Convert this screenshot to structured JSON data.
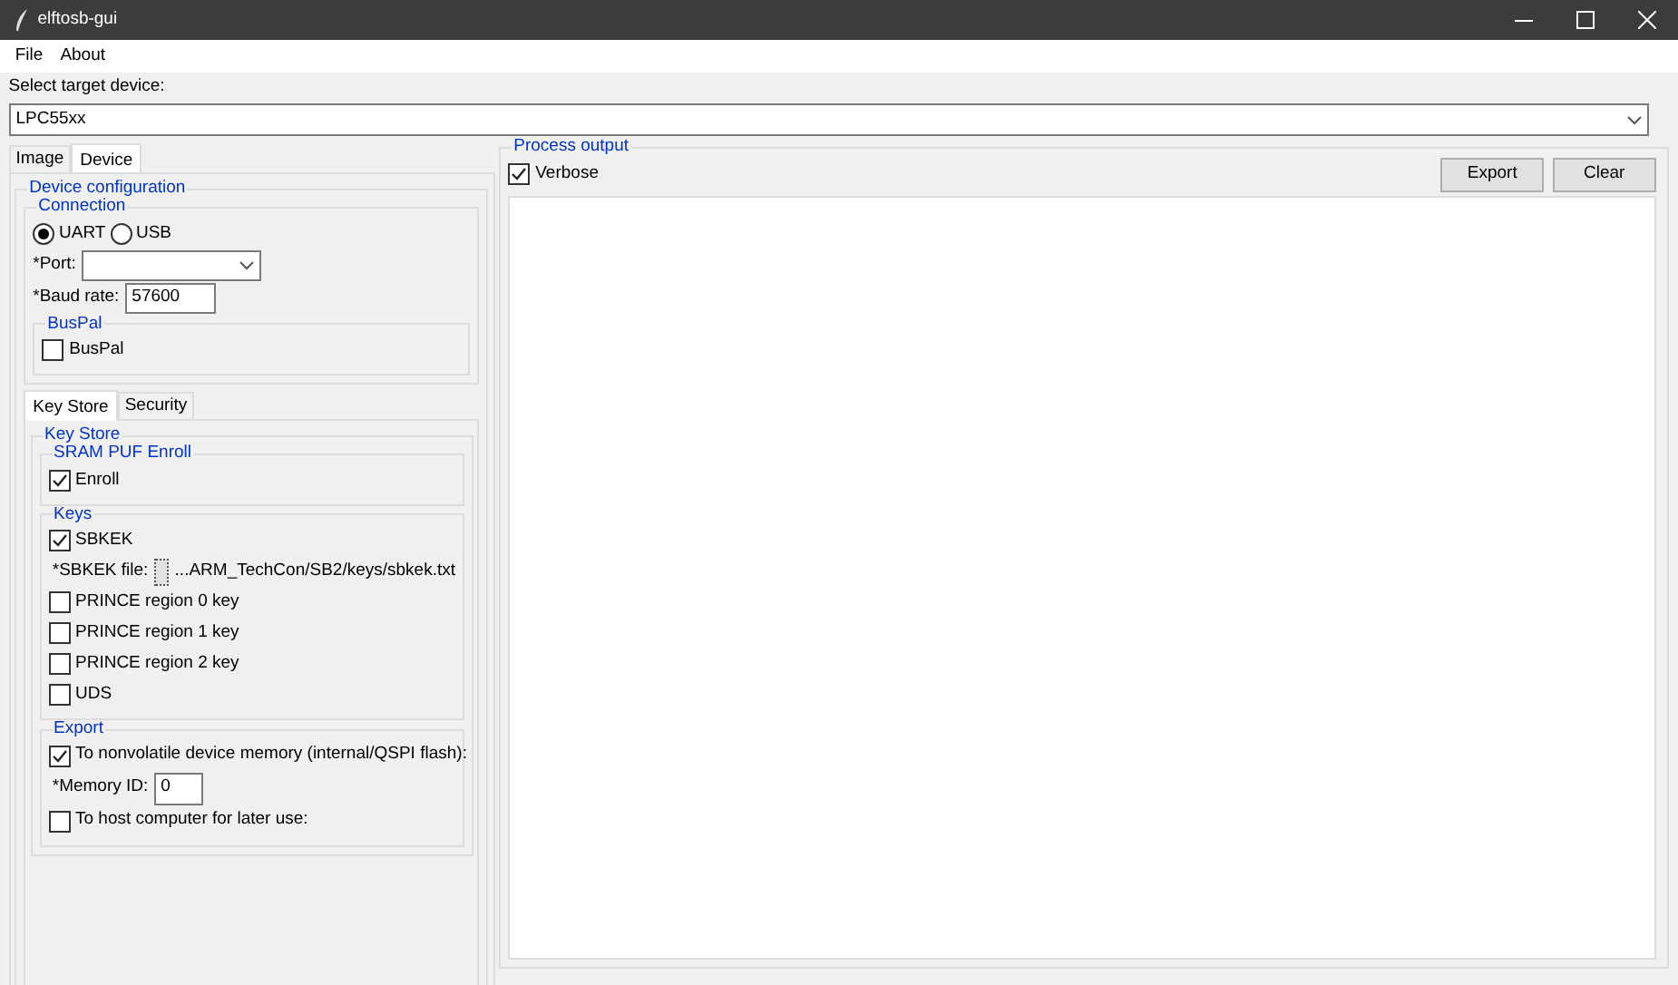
{
  "window": {
    "title": "elftosb-gui"
  },
  "menu": [
    "File",
    "About"
  ],
  "target_device": {
    "label": "Select target device:",
    "value": "LPC55xx"
  },
  "main_tabs": [
    {
      "label": "Image",
      "selected": false
    },
    {
      "label": "Device",
      "selected": true
    }
  ],
  "device_configuration": {
    "title": "Device configuration",
    "connection": {
      "title": "Connection",
      "radios": [
        {
          "label": "UART",
          "selected": true
        },
        {
          "label": "USB",
          "selected": false
        }
      ],
      "port": {
        "label": "*Port:"
      },
      "baud_rate": {
        "label": "*Baud rate:",
        "value": "57600"
      },
      "buspal": {
        "title": "BusPal",
        "checkbox": {
          "label": "BusPal",
          "checked": false
        }
      }
    },
    "sub_tabs": [
      {
        "label": "Key Store",
        "selected": true
      },
      {
        "label": "Security",
        "selected": false
      }
    ],
    "key_store": {
      "title": "Key Store",
      "sram_puf": {
        "title": "SRAM PUF Enroll",
        "checkbox": {
          "label": "Enroll",
          "checked": true
        }
      },
      "keys": {
        "title": "Keys",
        "items": [
          {
            "kind": "checkbox",
            "label": "SBKEK",
            "checked": true
          },
          {
            "kind": "file",
            "label": "*SBKEK file:",
            "value": "...ARM_TechCon/SB2/keys/sbkek.txt"
          },
          {
            "kind": "checkbox",
            "label": "PRINCE region 0 key",
            "checked": false
          },
          {
            "kind": "checkbox",
            "label": "PRINCE region 1 key",
            "checked": false
          },
          {
            "kind": "checkbox",
            "label": "PRINCE region 2 key",
            "checked": false
          },
          {
            "kind": "checkbox",
            "label": "UDS",
            "checked": false
          }
        ]
      },
      "export": {
        "title": "Export",
        "items": [
          {
            "kind": "checkbox",
            "label": "To nonvolatile device memory (internal/QSPI flash):",
            "checked": true
          },
          {
            "kind": "field",
            "label": "*Memory ID:",
            "value": "0"
          },
          {
            "kind": "checkbox",
            "label": "To host computer for later use:",
            "checked": false
          }
        ]
      }
    }
  },
  "process_output": {
    "title": "Process output",
    "verbose": {
      "label": "Verbose",
      "checked": true
    },
    "buttons": [
      "Export",
      "Clear"
    ]
  }
}
